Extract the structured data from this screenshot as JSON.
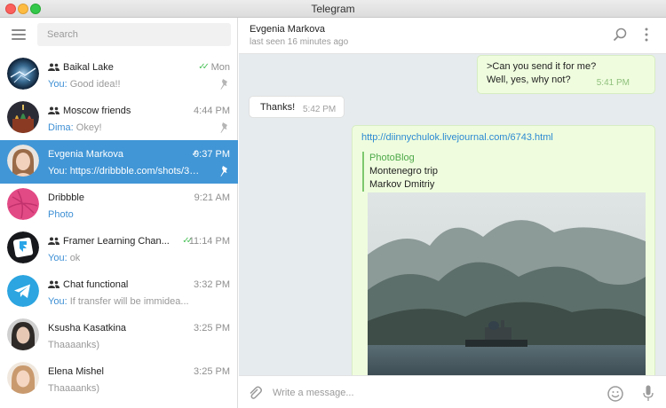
{
  "window": {
    "title": "Telegram"
  },
  "search": {
    "placeholder": "Search"
  },
  "chats": [
    {
      "name": "Baikal Lake",
      "group": true,
      "time": "Mon",
      "sender": "You:",
      "preview": "Good idea!!",
      "status": "read",
      "pinned": true,
      "active": false
    },
    {
      "name": "Moscow friends",
      "group": true,
      "time": "4:44 PM",
      "sender": "Dima:",
      "preview": "Okey!",
      "status": "",
      "pinned": true,
      "active": false
    },
    {
      "name": "Evgenia Markova",
      "group": false,
      "time": "9:37 PM",
      "sender": "You:",
      "preview": "https://dribbble.com/shots/327...",
      "status": "sent",
      "pinned": true,
      "active": true
    },
    {
      "name": "Dribbble",
      "group": false,
      "time": "9:21 AM",
      "sender": "",
      "preview": "Photo",
      "status": "",
      "pinned": false,
      "active": false
    },
    {
      "name": "Framer Learning Chan...",
      "group": true,
      "time": "11:14 PM",
      "sender": "You:",
      "preview": "ok",
      "status": "read",
      "pinned": false,
      "active": false
    },
    {
      "name": "Chat functional",
      "group": true,
      "time": "3:32 PM",
      "sender": "You:",
      "preview": "If transfer will be immidea...",
      "status": "",
      "pinned": false,
      "active": false
    },
    {
      "name": "Ksusha Kasatkina",
      "group": false,
      "time": "3:25 PM",
      "sender": "",
      "preview": "Thaaaanks)",
      "status": "",
      "pinned": false,
      "active": false
    },
    {
      "name": "Elena Mishel",
      "group": false,
      "time": "3:25 PM",
      "sender": "",
      "preview": "Thaaaanks)",
      "status": "",
      "pinned": false,
      "active": false
    }
  ],
  "peer": {
    "name": "Evgenia Markova",
    "status": "last seen 16 minutes ago"
  },
  "messages": {
    "m1": {
      "line1": ">Can you send it for me?",
      "line2": "Well, yes, why not?",
      "time": "5:41 PM"
    },
    "m2": {
      "text": "Thanks!",
      "time": "5:42 PM"
    },
    "m3": {
      "url": "http://diinnychulok.livejournal.com/6743.html",
      "site": "PhotoBlog",
      "title": "Montenegro trip",
      "author": "Markov Dmitriy"
    }
  },
  "compose": {
    "placeholder": "Write a message..."
  },
  "colors": {
    "accent": "#4196d6",
    "outgoing": "#effdde",
    "read_check": "#4ec35c",
    "link": "#2c89d2"
  },
  "icons": [
    "menu-icon",
    "group-icon",
    "pin-icon",
    "search-icon",
    "more-icon",
    "attach-icon",
    "emoji-icon",
    "microphone-icon"
  ]
}
